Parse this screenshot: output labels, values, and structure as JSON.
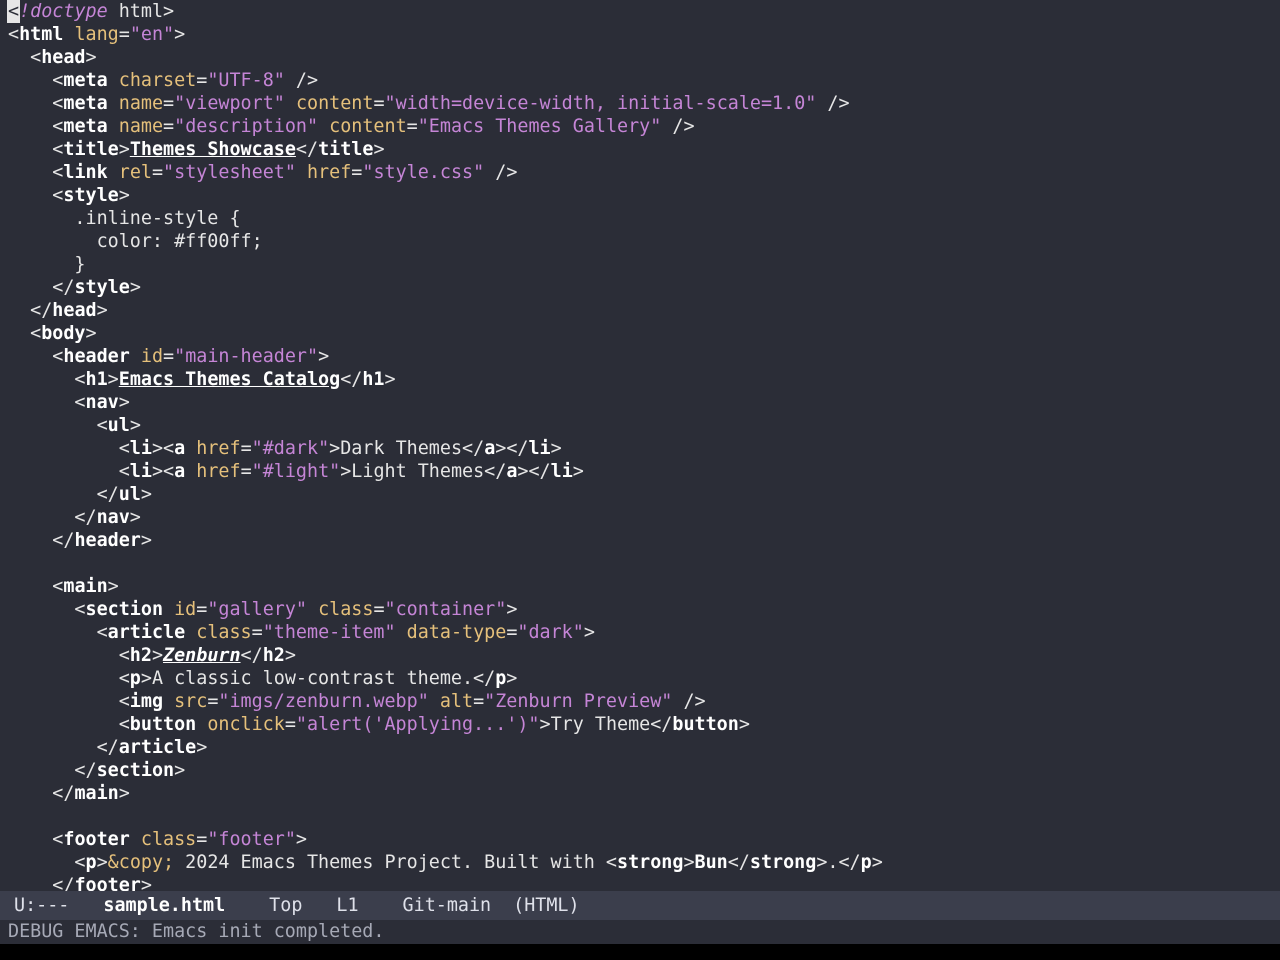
{
  "editor": {
    "lines": [
      [
        [
          "cursor",
          "<"
        ],
        [
          "t-doctype",
          "!doctype"
        ],
        [
          "t-punct",
          " html>"
        ]
      ],
      [
        [
          "t-punct",
          "<"
        ],
        [
          "t-tag",
          "html"
        ],
        [
          "t-punct",
          " "
        ],
        [
          "t-attr",
          "lang"
        ],
        [
          "t-punct",
          "="
        ],
        [
          "t-str",
          "\"en\""
        ],
        [
          "t-punct",
          ">"
        ]
      ],
      [
        [
          "t-punct",
          "  <"
        ],
        [
          "t-tag",
          "head"
        ],
        [
          "t-punct",
          ">"
        ]
      ],
      [
        [
          "t-punct",
          "    <"
        ],
        [
          "t-tag",
          "meta"
        ],
        [
          "t-punct",
          " "
        ],
        [
          "t-attr",
          "charset"
        ],
        [
          "t-punct",
          "="
        ],
        [
          "t-str",
          "\"UTF-8\""
        ],
        [
          "t-punct",
          " />"
        ]
      ],
      [
        [
          "t-punct",
          "    <"
        ],
        [
          "t-tag",
          "meta"
        ],
        [
          "t-punct",
          " "
        ],
        [
          "t-attr",
          "name"
        ],
        [
          "t-punct",
          "="
        ],
        [
          "t-str",
          "\"viewport\""
        ],
        [
          "t-punct",
          " "
        ],
        [
          "t-attr",
          "content"
        ],
        [
          "t-punct",
          "="
        ],
        [
          "t-str",
          "\"width=device-width, initial-scale=1.0\""
        ],
        [
          "t-punct",
          " />"
        ]
      ],
      [
        [
          "t-punct",
          "    <"
        ],
        [
          "t-tag",
          "meta"
        ],
        [
          "t-punct",
          " "
        ],
        [
          "t-attr",
          "name"
        ],
        [
          "t-punct",
          "="
        ],
        [
          "t-str",
          "\"description\""
        ],
        [
          "t-punct",
          " "
        ],
        [
          "t-attr",
          "content"
        ],
        [
          "t-punct",
          "="
        ],
        [
          "t-str",
          "\"Emacs Themes Gallery\""
        ],
        [
          "t-punct",
          " />"
        ]
      ],
      [
        [
          "t-punct",
          "    <"
        ],
        [
          "t-tag",
          "title"
        ],
        [
          "t-punct",
          ">"
        ],
        [
          "t-u",
          "Themes Showcase"
        ],
        [
          "t-punct",
          "</"
        ],
        [
          "t-tag",
          "title"
        ],
        [
          "t-punct",
          ">"
        ]
      ],
      [
        [
          "t-punct",
          "    <"
        ],
        [
          "t-tag",
          "link"
        ],
        [
          "t-punct",
          " "
        ],
        [
          "t-attr",
          "rel"
        ],
        [
          "t-punct",
          "="
        ],
        [
          "t-str",
          "\"stylesheet\""
        ],
        [
          "t-punct",
          " "
        ],
        [
          "t-attr",
          "href"
        ],
        [
          "t-punct",
          "="
        ],
        [
          "t-str",
          "\"style.css\""
        ],
        [
          "t-punct",
          " />"
        ]
      ],
      [
        [
          "t-punct",
          "    <"
        ],
        [
          "t-tag",
          "style"
        ],
        [
          "t-punct",
          ">"
        ]
      ],
      [
        [
          "t-text",
          "      .inline-style {"
        ]
      ],
      [
        [
          "t-text",
          "        color: #ff00ff;"
        ]
      ],
      [
        [
          "t-text",
          "      }"
        ]
      ],
      [
        [
          "t-punct",
          "    </"
        ],
        [
          "t-tag",
          "style"
        ],
        [
          "t-punct",
          ">"
        ]
      ],
      [
        [
          "t-punct",
          "  </"
        ],
        [
          "t-tag",
          "head"
        ],
        [
          "t-punct",
          ">"
        ]
      ],
      [
        [
          "t-punct",
          "  <"
        ],
        [
          "t-tag",
          "body"
        ],
        [
          "t-punct",
          ">"
        ]
      ],
      [
        [
          "t-punct",
          "    <"
        ],
        [
          "t-tag",
          "header"
        ],
        [
          "t-punct",
          " "
        ],
        [
          "t-attr",
          "id"
        ],
        [
          "t-punct",
          "="
        ],
        [
          "t-str",
          "\"main-header\""
        ],
        [
          "t-punct",
          ">"
        ]
      ],
      [
        [
          "t-punct",
          "      <"
        ],
        [
          "t-tag",
          "h1"
        ],
        [
          "t-punct",
          ">"
        ],
        [
          "t-u",
          "Emacs Themes Catalog"
        ],
        [
          "t-punct",
          "</"
        ],
        [
          "t-tag",
          "h1"
        ],
        [
          "t-punct",
          ">"
        ]
      ],
      [
        [
          "t-punct",
          "      <"
        ],
        [
          "t-tag",
          "nav"
        ],
        [
          "t-punct",
          ">"
        ]
      ],
      [
        [
          "t-punct",
          "        <"
        ],
        [
          "t-tag",
          "ul"
        ],
        [
          "t-punct",
          ">"
        ]
      ],
      [
        [
          "t-punct",
          "          <"
        ],
        [
          "t-tag",
          "li"
        ],
        [
          "t-punct",
          "><"
        ],
        [
          "t-tag",
          "a"
        ],
        [
          "t-punct",
          " "
        ],
        [
          "t-attr",
          "href"
        ],
        [
          "t-punct",
          "="
        ],
        [
          "t-str",
          "\"#dark\""
        ],
        [
          "t-punct",
          ">"
        ],
        [
          "t-text",
          "Dark Themes"
        ],
        [
          "t-punct",
          "</"
        ],
        [
          "t-tag",
          "a"
        ],
        [
          "t-punct",
          "></"
        ],
        [
          "t-tag",
          "li"
        ],
        [
          "t-punct",
          ">"
        ]
      ],
      [
        [
          "t-punct",
          "          <"
        ],
        [
          "t-tag",
          "li"
        ],
        [
          "t-punct",
          "><"
        ],
        [
          "t-tag",
          "a"
        ],
        [
          "t-punct",
          " "
        ],
        [
          "t-attr",
          "href"
        ],
        [
          "t-punct",
          "="
        ],
        [
          "t-str",
          "\"#light\""
        ],
        [
          "t-punct",
          ">"
        ],
        [
          "t-text",
          "Light Themes"
        ],
        [
          "t-punct",
          "</"
        ],
        [
          "t-tag",
          "a"
        ],
        [
          "t-punct",
          "></"
        ],
        [
          "t-tag",
          "li"
        ],
        [
          "t-punct",
          ">"
        ]
      ],
      [
        [
          "t-punct",
          "        </"
        ],
        [
          "t-tag",
          "ul"
        ],
        [
          "t-punct",
          ">"
        ]
      ],
      [
        [
          "t-punct",
          "      </"
        ],
        [
          "t-tag",
          "nav"
        ],
        [
          "t-punct",
          ">"
        ]
      ],
      [
        [
          "t-punct",
          "    </"
        ],
        [
          "t-tag",
          "header"
        ],
        [
          "t-punct",
          ">"
        ]
      ],
      [
        [
          "t-text",
          ""
        ]
      ],
      [
        [
          "t-punct",
          "    <"
        ],
        [
          "t-tag",
          "main"
        ],
        [
          "t-punct",
          ">"
        ]
      ],
      [
        [
          "t-punct",
          "      <"
        ],
        [
          "t-tag",
          "section"
        ],
        [
          "t-punct",
          " "
        ],
        [
          "t-attr",
          "id"
        ],
        [
          "t-punct",
          "="
        ],
        [
          "t-str",
          "\"gallery\""
        ],
        [
          "t-punct",
          " "
        ],
        [
          "t-attr",
          "class"
        ],
        [
          "t-punct",
          "="
        ],
        [
          "t-str",
          "\"container\""
        ],
        [
          "t-punct",
          ">"
        ]
      ],
      [
        [
          "t-punct",
          "        <"
        ],
        [
          "t-tag",
          "article"
        ],
        [
          "t-punct",
          " "
        ],
        [
          "t-attr",
          "class"
        ],
        [
          "t-punct",
          "="
        ],
        [
          "t-str",
          "\"theme-item\""
        ],
        [
          "t-punct",
          " "
        ],
        [
          "t-attr",
          "data-type"
        ],
        [
          "t-punct",
          "="
        ],
        [
          "t-str",
          "\"dark\""
        ],
        [
          "t-punct",
          ">"
        ]
      ],
      [
        [
          "t-punct",
          "          <"
        ],
        [
          "t-tag",
          "h2"
        ],
        [
          "t-punct",
          ">"
        ],
        [
          "t-ui",
          "Zenburn"
        ],
        [
          "t-punct",
          "</"
        ],
        [
          "t-tag",
          "h2"
        ],
        [
          "t-punct",
          ">"
        ]
      ],
      [
        [
          "t-punct",
          "          <"
        ],
        [
          "t-tag",
          "p"
        ],
        [
          "t-punct",
          ">"
        ],
        [
          "t-text",
          "A classic low-contrast theme."
        ],
        [
          "t-punct",
          "</"
        ],
        [
          "t-tag",
          "p"
        ],
        [
          "t-punct",
          ">"
        ]
      ],
      [
        [
          "t-punct",
          "          <"
        ],
        [
          "t-tag",
          "img"
        ],
        [
          "t-punct",
          " "
        ],
        [
          "t-attr",
          "src"
        ],
        [
          "t-punct",
          "="
        ],
        [
          "t-str",
          "\"imgs/zenburn.webp\""
        ],
        [
          "t-punct",
          " "
        ],
        [
          "t-attr",
          "alt"
        ],
        [
          "t-punct",
          "="
        ],
        [
          "t-str",
          "\"Zenburn Preview\""
        ],
        [
          "t-punct",
          " />"
        ]
      ],
      [
        [
          "t-punct",
          "          <"
        ],
        [
          "t-tag",
          "button"
        ],
        [
          "t-punct",
          " "
        ],
        [
          "t-attr",
          "onclick"
        ],
        [
          "t-punct",
          "="
        ],
        [
          "t-str",
          "\"alert('Applying...')\""
        ],
        [
          "t-punct",
          ">"
        ],
        [
          "t-text",
          "Try Theme"
        ],
        [
          "t-punct",
          "</"
        ],
        [
          "t-tag",
          "button"
        ],
        [
          "t-punct",
          ">"
        ]
      ],
      [
        [
          "t-punct",
          "        </"
        ],
        [
          "t-tag",
          "article"
        ],
        [
          "t-punct",
          ">"
        ]
      ],
      [
        [
          "t-punct",
          "      </"
        ],
        [
          "t-tag",
          "section"
        ],
        [
          "t-punct",
          ">"
        ]
      ],
      [
        [
          "t-punct",
          "    </"
        ],
        [
          "t-tag",
          "main"
        ],
        [
          "t-punct",
          ">"
        ]
      ],
      [
        [
          "t-text",
          ""
        ]
      ],
      [
        [
          "t-punct",
          "    <"
        ],
        [
          "t-tag",
          "footer"
        ],
        [
          "t-punct",
          " "
        ],
        [
          "t-attr",
          "class"
        ],
        [
          "t-punct",
          "="
        ],
        [
          "t-str",
          "\"footer\""
        ],
        [
          "t-punct",
          ">"
        ]
      ],
      [
        [
          "t-punct",
          "      <"
        ],
        [
          "t-tag",
          "p"
        ],
        [
          "t-punct",
          ">"
        ],
        [
          "t-entity",
          "&copy;"
        ],
        [
          "t-text",
          " 2024 Emacs Themes Project. Built with "
        ],
        [
          "t-punct",
          "<"
        ],
        [
          "t-tag",
          "strong"
        ],
        [
          "t-punct",
          ">"
        ],
        [
          "t-tag",
          "Bun"
        ],
        [
          "t-punct",
          "</"
        ],
        [
          "t-tag",
          "strong"
        ],
        [
          "t-punct",
          ">"
        ],
        [
          "t-text",
          "."
        ],
        [
          "t-punct",
          "</"
        ],
        [
          "t-tag",
          "p"
        ],
        [
          "t-punct",
          ">"
        ]
      ],
      [
        [
          "t-punct",
          "    </"
        ],
        [
          "t-tag",
          "footer"
        ],
        [
          "t-punct",
          ">"
        ]
      ]
    ]
  },
  "modeline": {
    "state": "U:---",
    "buffer": "sample.html",
    "position": "Top",
    "line": "L1",
    "vc": "Git-main",
    "mode": "(HTML)"
  },
  "echo": {
    "message": "DEBUG EMACS: Emacs init completed."
  },
  "colors": {
    "background": "#2b2d37",
    "modeline_bg": "#3b3e4c",
    "tag": "#ffffff",
    "attribute": "#e5c07b",
    "string": "#c585d6"
  }
}
